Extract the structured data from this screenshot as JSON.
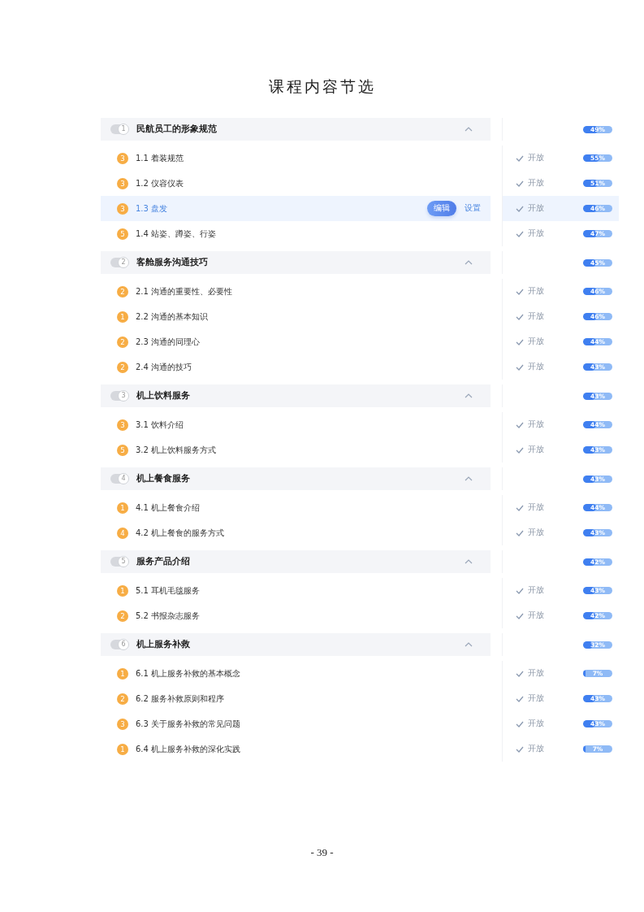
{
  "title": "课程内容节选",
  "chapters": [
    {
      "number": "1",
      "title": "民航员工的形象规范",
      "reading": "49%",
      "level": 0.49,
      "lessons": [
        {
          "badge": "3",
          "title": "1.1 着装规范",
          "status": "开放",
          "reading": "55%",
          "level": 0.55,
          "selected": false
        },
        {
          "badge": "3",
          "title": "1.2 仪容仪表",
          "status": "开放",
          "reading": "51%",
          "level": 0.51,
          "selected": false
        },
        {
          "badge": "3",
          "title": "1.3 盘发",
          "status": "开放",
          "reading": "46%",
          "level": 0.46,
          "selected": true,
          "actions": [
            "编辑",
            "设置"
          ]
        },
        {
          "badge": "5",
          "title": "1.4 站姿、蹲姿、行姿",
          "status": "开放",
          "reading": "47%",
          "level": 0.47,
          "selected": false
        }
      ]
    },
    {
      "number": "2",
      "title": "客舱服务沟通技巧",
      "reading": "45%",
      "level": 0.45,
      "lessons": [
        {
          "badge": "2",
          "title": "2.1 沟通的重要性、必要性",
          "status": "开放",
          "reading": "46%",
          "level": 0.46,
          "selected": false
        },
        {
          "badge": "1",
          "title": "2.2 沟通的基本知识",
          "status": "开放",
          "reading": "46%",
          "level": 0.46,
          "selected": false
        },
        {
          "badge": "2",
          "title": "2.3 沟通的同理心",
          "status": "开放",
          "reading": "44%",
          "level": 0.44,
          "selected": false
        },
        {
          "badge": "2",
          "title": "2.4 沟通的技巧",
          "status": "开放",
          "reading": "43%",
          "level": 0.43,
          "selected": false
        }
      ]
    },
    {
      "number": "3",
      "title": "机上饮料服务",
      "reading": "43%",
      "level": 0.43,
      "lessons": [
        {
          "badge": "3",
          "title": "3.1 饮料介绍",
          "status": "开放",
          "reading": "44%",
          "level": 0.44,
          "selected": false
        },
        {
          "badge": "5",
          "title": "3.2 机上饮料服务方式",
          "status": "开放",
          "reading": "43%",
          "level": 0.43,
          "selected": false
        }
      ]
    },
    {
      "number": "4",
      "title": "机上餐食服务",
      "reading": "43%",
      "level": 0.43,
      "lessons": [
        {
          "badge": "1",
          "title": "4.1 机上餐食介绍",
          "status": "开放",
          "reading": "44%",
          "level": 0.44,
          "selected": false
        },
        {
          "badge": "4",
          "title": "4.2 机上餐食的服务方式",
          "status": "开放",
          "reading": "43%",
          "level": 0.43,
          "selected": false
        }
      ]
    },
    {
      "number": "5",
      "title": "服务产品介绍",
      "reading": "42%",
      "level": 0.42,
      "lessons": [
        {
          "badge": "1",
          "title": "5.1 耳机毛毯服务",
          "status": "开放",
          "reading": "43%",
          "level": 0.43,
          "selected": false
        },
        {
          "badge": "2",
          "title": "5.2 书报杂志服务",
          "status": "开放",
          "reading": "42%",
          "level": 0.42,
          "selected": false
        }
      ]
    },
    {
      "number": "6",
      "title": "机上服务补救",
      "reading": "32%",
      "level": 0.32,
      "lessons": [
        {
          "badge": "1",
          "title": "6.1 机上服务补救的基本概念",
          "status": "开放",
          "reading": "7%",
          "level": 0.07,
          "selected": false
        },
        {
          "badge": "2",
          "title": "6.2 服务补救原则和程序",
          "status": "开放",
          "reading": "43%",
          "level": 0.43,
          "selected": false
        },
        {
          "badge": "3",
          "title": "6.3 关于服务补救的常见问题",
          "status": "开放",
          "reading": "43%",
          "level": 0.43,
          "selected": false
        },
        {
          "badge": "1",
          "title": "6.4 机上服务补救的深化实践",
          "status": "开放",
          "reading": "7%",
          "level": 0.07,
          "selected": false
        }
      ]
    }
  ],
  "page_number": "- 39 -"
}
